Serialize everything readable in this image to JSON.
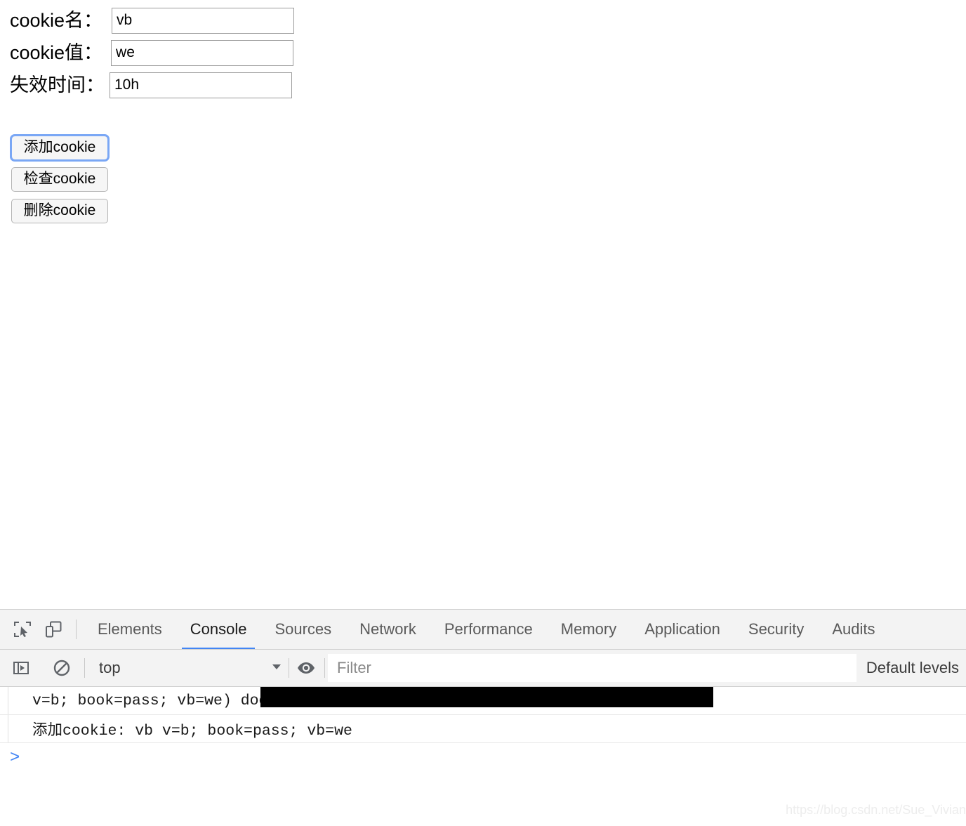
{
  "page": {
    "form": {
      "rows": [
        {
          "label": "cookie名：",
          "value": "vb",
          "name": "cookie-name"
        },
        {
          "label": "cookie值：",
          "value": "we",
          "name": "cookie-value"
        },
        {
          "label": "失效时间：",
          "value": "10h",
          "name": "cookie-expiry"
        }
      ],
      "buttons": [
        {
          "label": "添加cookie",
          "focused": true
        },
        {
          "label": "检查cookie",
          "focused": false
        },
        {
          "label": "删除cookie",
          "focused": false
        }
      ]
    }
  },
  "devtools": {
    "toolbar_icons": [
      {
        "name": "inspect-element-icon"
      },
      {
        "name": "device-toolbar-icon"
      }
    ],
    "tabs": [
      {
        "label": "Elements",
        "active": false
      },
      {
        "label": "Console",
        "active": true
      },
      {
        "label": "Sources",
        "active": false
      },
      {
        "label": "Network",
        "active": false
      },
      {
        "label": "Performance",
        "active": false
      },
      {
        "label": "Memory",
        "active": false
      },
      {
        "label": "Application",
        "active": false
      },
      {
        "label": "Security",
        "active": false
      },
      {
        "label": "Audits",
        "active": false
      }
    ],
    "console_toolbar": {
      "sidebar_toggle_icon": "console-sidebar-icon",
      "clear_icon": "clear-console-icon",
      "context": "top",
      "caret_icon": "chevron-down-icon",
      "eye_icon": "live-expression-eye-icon",
      "filter_placeholder": "Filter",
      "filter_value": "",
      "level": "Default levels"
    },
    "console_rows": [
      {
        "text": "v=b; book=pass; vb=we ",
        "tail": ") document.cookie",
        "redacted": true
      },
      {
        "text": "添加cookie: vb v=b; book=pass; vb=we",
        "tail": "",
        "redacted": false
      }
    ],
    "prompt": ">"
  },
  "watermark": "https://blog.csdn.net/Sue_Vivian",
  "colors": {
    "accent": "#4285f4",
    "tabbar_bg": "#f3f3f3",
    "border": "#cfcfcf",
    "focus_ring": "#7aa7f5"
  }
}
